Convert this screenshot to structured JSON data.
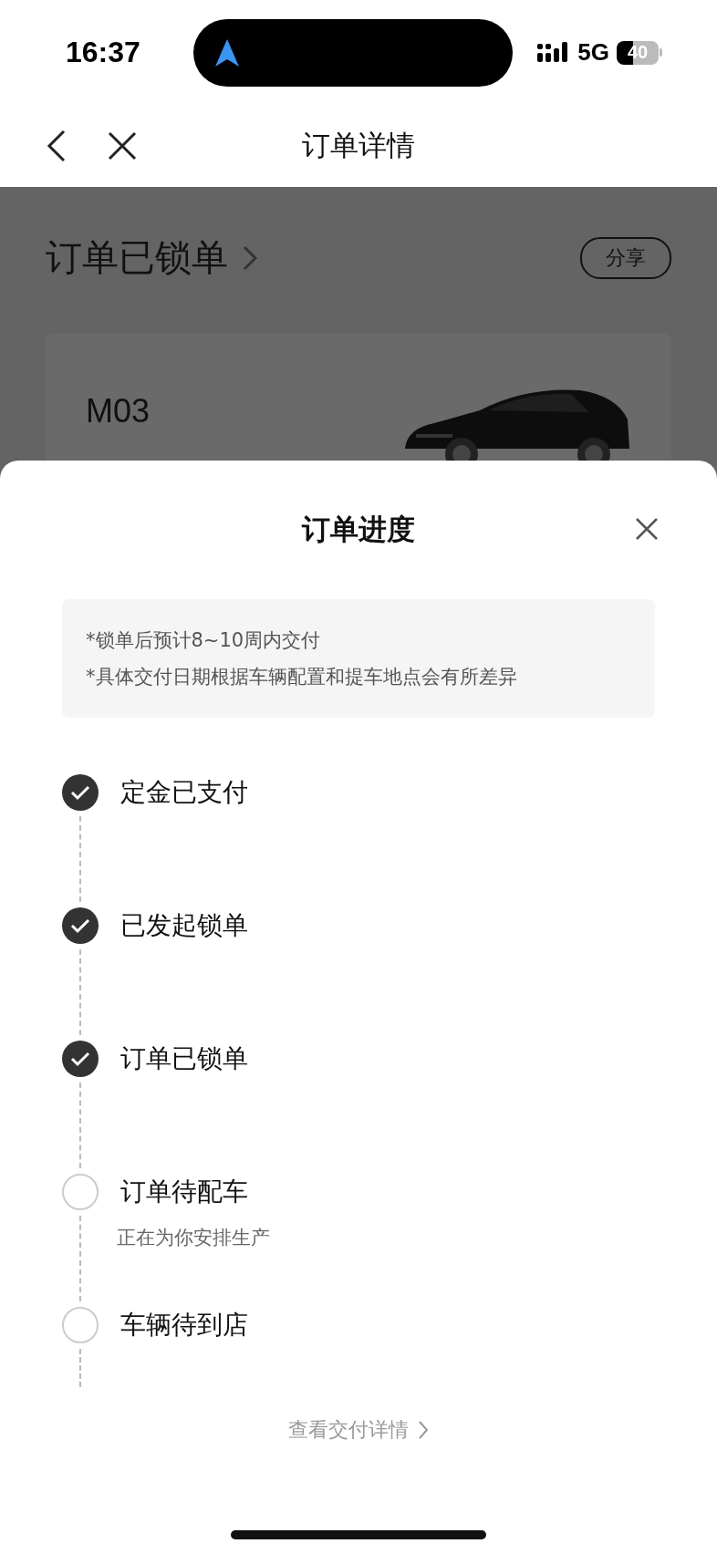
{
  "status_bar": {
    "time": "16:37",
    "network": "5G",
    "battery": "40"
  },
  "nav": {
    "title": "订单详情"
  },
  "page": {
    "status_title": "订单已锁单",
    "share_button": "分享",
    "car_card": {
      "model": "M03"
    }
  },
  "sheet": {
    "title": "订单进度",
    "notes": [
      "*锁单后预计8~10周内交付",
      "*具体交付日期根据车辆配置和提车地点会有所差异"
    ],
    "steps": [
      {
        "label": "定金已支付",
        "completed": true
      },
      {
        "label": "已发起锁单",
        "completed": true
      },
      {
        "label": "订单已锁单",
        "completed": true
      },
      {
        "label": "订单待配车",
        "completed": false,
        "detail": "正在为你安排生产"
      },
      {
        "label": "车辆待到店",
        "completed": false
      }
    ],
    "footer_link": "查看交付详情"
  }
}
